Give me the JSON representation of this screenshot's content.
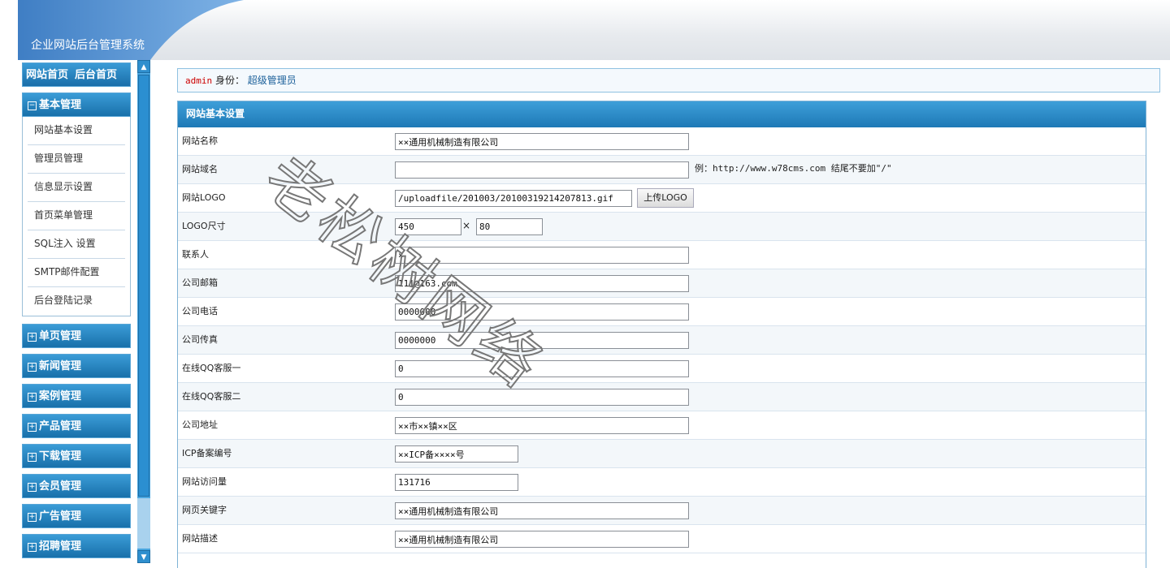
{
  "header": {
    "title": "企业网站后台管理系统"
  },
  "sidebar": {
    "top_links": [
      "网站首页",
      "后台首页"
    ],
    "expanded_group": {
      "toggle": "⊟",
      "label": "基本管理"
    },
    "submenu": [
      "网站基本设置",
      "管理员管理",
      "信息显示设置",
      "首页菜单管理",
      "SQL注入 设置",
      "SMTP邮件配置",
      "后台登陆记录"
    ],
    "collapsed_groups": [
      {
        "toggle": "⊞",
        "label": "单页管理"
      },
      {
        "toggle": "⊞",
        "label": "新闻管理"
      },
      {
        "toggle": "⊞",
        "label": "案例管理"
      },
      {
        "toggle": "⊞",
        "label": "产品管理"
      },
      {
        "toggle": "⊞",
        "label": "下载管理"
      },
      {
        "toggle": "⊞",
        "label": "会员管理"
      },
      {
        "toggle": "⊞",
        "label": "广告管理"
      },
      {
        "toggle": "⊞",
        "label": "招聘管理"
      }
    ]
  },
  "userbar": {
    "username": "admin",
    "identity_label": "身份：",
    "role": "超级管理员"
  },
  "panel": {
    "title": "网站基本设置",
    "fields": [
      {
        "label": "网站名称",
        "value": "××通用机械制造有限公司"
      },
      {
        "label": "网站域名",
        "value": "",
        "hint": "例：http://www.w78cms.com 结尾不要加\"/\""
      },
      {
        "label": "网站LOGO",
        "value": "/uploadfile/201003/20100319214207813.gif",
        "button": "上传LOGO"
      },
      {
        "label": "LOGO尺寸",
        "value": "450",
        "value2": "80",
        "separator": "×"
      },
      {
        "label": "联系人",
        "value": "×"
      },
      {
        "label": "公司邮箱",
        "value": "111@163.com"
      },
      {
        "label": "公司电话",
        "value": "0000000"
      },
      {
        "label": "公司传真",
        "value": "0000000"
      },
      {
        "label": "在线QQ客服一",
        "value": "0"
      },
      {
        "label": "在线QQ客服二",
        "value": "0"
      },
      {
        "label": "公司地址",
        "value": "××市××镇××区"
      },
      {
        "label": "ICP备案编号",
        "value": "××ICP备××××号"
      },
      {
        "label": "网站访问量",
        "value": "131716"
      },
      {
        "label": "网页关键字",
        "value": "××通用机械制造有限公司"
      },
      {
        "label": "网站描述",
        "value": "××通用机械制造有限公司"
      }
    ]
  },
  "watermark": {
    "text": "老松树网络"
  },
  "colors": {
    "accent": "#2a85c6",
    "header_arc": "#4f8fd0"
  }
}
